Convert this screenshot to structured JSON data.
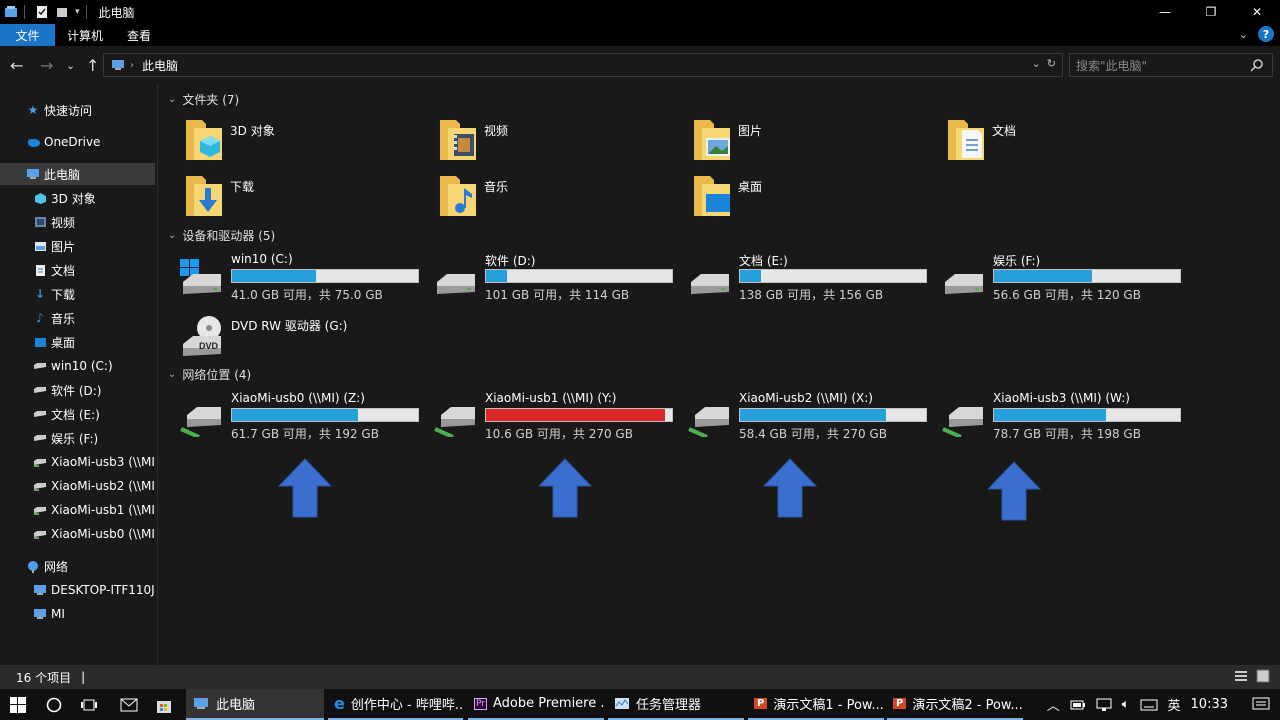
{
  "window": {
    "title": "此电脑"
  },
  "ribbon": {
    "tabs": [
      "文件",
      "计算机",
      "查看"
    ]
  },
  "address": {
    "crumb": "此电脑",
    "search_placeholder": "搜索\"此电脑\""
  },
  "sidebar": {
    "items": [
      {
        "label": "快速访问",
        "icon": "star-icon"
      },
      {
        "label": "OneDrive",
        "icon": "cloud-icon"
      },
      {
        "label": "此电脑",
        "icon": "computer-icon",
        "selected": true
      },
      {
        "label": "3D 对象",
        "icon": "cube-icon"
      },
      {
        "label": "视频",
        "icon": "video-icon"
      },
      {
        "label": "图片",
        "icon": "picture-icon"
      },
      {
        "label": "文档",
        "icon": "document-icon"
      },
      {
        "label": "下载",
        "icon": "download-icon"
      },
      {
        "label": "音乐",
        "icon": "music-icon"
      },
      {
        "label": "桌面",
        "icon": "desktop-icon"
      },
      {
        "label": "win10 (C:)",
        "icon": "drive-icon"
      },
      {
        "label": "软件 (D:)",
        "icon": "drive-icon"
      },
      {
        "label": "文档 (E:)",
        "icon": "drive-icon"
      },
      {
        "label": "娱乐 (F:)",
        "icon": "drive-icon"
      },
      {
        "label": "XiaoMi-usb3 (\\\\MI",
        "icon": "network-drive-icon"
      },
      {
        "label": "XiaoMi-usb2 (\\\\MI",
        "icon": "network-drive-icon"
      },
      {
        "label": "XiaoMi-usb1 (\\\\MI",
        "icon": "network-drive-icon"
      },
      {
        "label": "XiaoMi-usb0 (\\\\MI",
        "icon": "network-drive-icon"
      },
      {
        "label": "网络",
        "icon": "network-icon"
      },
      {
        "label": "DESKTOP-ITF110J",
        "icon": "computer-icon"
      },
      {
        "label": "MI",
        "icon": "computer-icon"
      }
    ]
  },
  "sections": {
    "folders": {
      "title": "文件夹 (7)",
      "items": [
        "3D 对象",
        "视频",
        "图片",
        "文档",
        "下载",
        "音乐",
        "桌面"
      ]
    },
    "drives": {
      "title": "设备和驱动器 (5)",
      "items": [
        {
          "name": "win10 (C:)",
          "free": "41.0 GB 可用，共 75.0 GB",
          "used_fraction": 0.453
        },
        {
          "name": "软件 (D:)",
          "free": "101 GB 可用，共 114 GB",
          "used_fraction": 0.114
        },
        {
          "name": "文档 (E:)",
          "free": "138 GB 可用，共 156 GB",
          "used_fraction": 0.115
        },
        {
          "name": "娱乐 (F:)",
          "free": "56.6 GB 可用，共 120 GB",
          "used_fraction": 0.528
        }
      ],
      "dvd": {
        "name": "DVD RW 驱动器 (G:)",
        "icon_text": "DVD"
      }
    },
    "network": {
      "title": "网络位置 (4)",
      "items": [
        {
          "name": "XiaoMi-usb0 (\\\\MI) (Z:)",
          "free": "61.7 GB 可用，共 192 GB",
          "used_fraction": 0.679
        },
        {
          "name": "XiaoMi-usb1 (\\\\MI) (Y:)",
          "free": "10.6 GB 可用，共 270 GB",
          "used_fraction": 0.961,
          "low": true
        },
        {
          "name": "XiaoMi-usb2 (\\\\MI) (X:)",
          "free": "58.4 GB 可用，共 270 GB",
          "used_fraction": 0.784
        },
        {
          "name": "XiaoMi-usb3 (\\\\MI) (W:)",
          "free": "78.7 GB 可用，共 198 GB",
          "used_fraction": 0.603
        }
      ]
    }
  },
  "status": {
    "count": "16 个项目",
    "cursor": "|"
  },
  "taskbar": {
    "apps": [
      {
        "label": "此电脑",
        "state": "active"
      },
      {
        "label": "创作中心 - 哔哩哔...",
        "state": "open"
      },
      {
        "label": "Adobe Premiere ...",
        "state": "open"
      },
      {
        "label": "任务管理器",
        "state": "open"
      },
      {
        "label": "演示文稿1 - Pow...",
        "state": "open"
      },
      {
        "label": "演示文稿2 - Pow...",
        "state": "open"
      }
    ],
    "ime": "英",
    "time": "10:33"
  },
  "colors": {
    "accent": "#1a74c8",
    "bar": "#26a0da",
    "bar_low": "#da2626",
    "arrow": "#3a6fd0"
  }
}
